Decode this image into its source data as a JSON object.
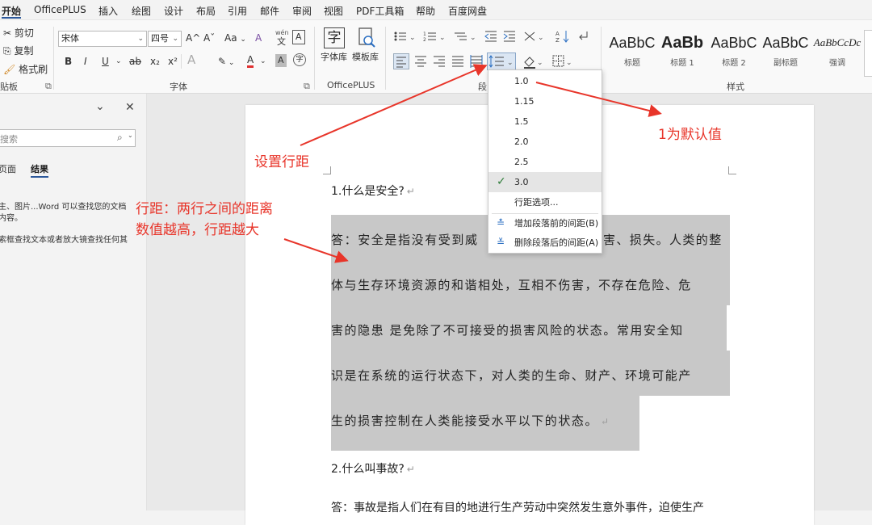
{
  "menu_tabs": [
    "开始",
    "OfficePLUS",
    "插入",
    "绘图",
    "设计",
    "布局",
    "引用",
    "邮件",
    "审阅",
    "视图",
    "PDF工具箱",
    "帮助",
    "百度网盘"
  ],
  "clipboard": {
    "cut": "剪切",
    "copy": "复制",
    "format_painter": "格式刷",
    "group_label": "贴板"
  },
  "font": {
    "name": "宋体",
    "size": "四号",
    "group_label": "字体",
    "grow": "A^",
    "shrink": "Aˇ",
    "case": "Aa",
    "clear": "A",
    "phonetic_top": "wén",
    "phonetic_bottom": "文",
    "border": "A",
    "bold": "B",
    "italic": "I",
    "underline": "U",
    "strike": "ab",
    "sub": "x₂",
    "sup": "x²",
    "effects": "A",
    "highlight": "✎",
    "color": "A",
    "shading": "A",
    "enclose": "字"
  },
  "officeplus": {
    "font_lib": "字体库",
    "template_lib": "模板库",
    "group_label": "OfficePLUS",
    "font_glyph": "字"
  },
  "paragraph": {
    "group_label": "段"
  },
  "styles": {
    "group_label": "样式",
    "items": [
      {
        "sample": "AaBbC",
        "name": "标题"
      },
      {
        "sample": "AaBb",
        "name": "标题 1"
      },
      {
        "sample": "AaBbC",
        "name": "标题 2"
      },
      {
        "sample": "AaBbC",
        "name": "副标题"
      },
      {
        "sample": "AaBbCcDc",
        "name": "强调"
      }
    ]
  },
  "nav_pane": {
    "search_placeholder": "搜索",
    "tab_pages": "页面",
    "tab_results": "结果",
    "help_line1": "主、图片...Word 可以查找您的文档",
    "help_line2": "内容。",
    "help_line3": "索框查找文本或者放大镜查找任何其"
  },
  "line_spacing_menu": {
    "options": [
      "1.0",
      "1.15",
      "1.5",
      "2.0",
      "2.5",
      "3.0"
    ],
    "selected": "3.0",
    "more": "行距选项...",
    "add_before": "增加段落前的间距(B)",
    "remove_after": "删除段落后的间距(A)"
  },
  "document": {
    "q1": "1.什么是安全?",
    "a1_lines": [
      "答：安全是指没有受到威",
      "体与生存环境资源的和谐相处，互相不伤害，不存在危险、危",
      "害的隐患  是免除了不可接受的损害风险的状态。常用安全知",
      "识是在系统的运行状态下，对人类的生命、财产、环境可能产",
      "生的损害控制在人类能接受水平以下的状态。"
    ],
    "a1_line1_tail": "害、损失。人类的整",
    "q2": "2.什么叫事故?",
    "a2_line1": "答：事故是指人们在有目的地进行生产劳动中突然发生意外事件，迫使生产"
  },
  "annotations": {
    "set_spacing": "设置行距",
    "default_value": "1为默认值",
    "spacing_line1": "行距：两行之间的距离",
    "spacing_line2": "数值越高，行距越大"
  },
  "colors": {
    "annotation": "#e8352a",
    "selection": "#c8c8c8",
    "accent": "#2b579a"
  }
}
